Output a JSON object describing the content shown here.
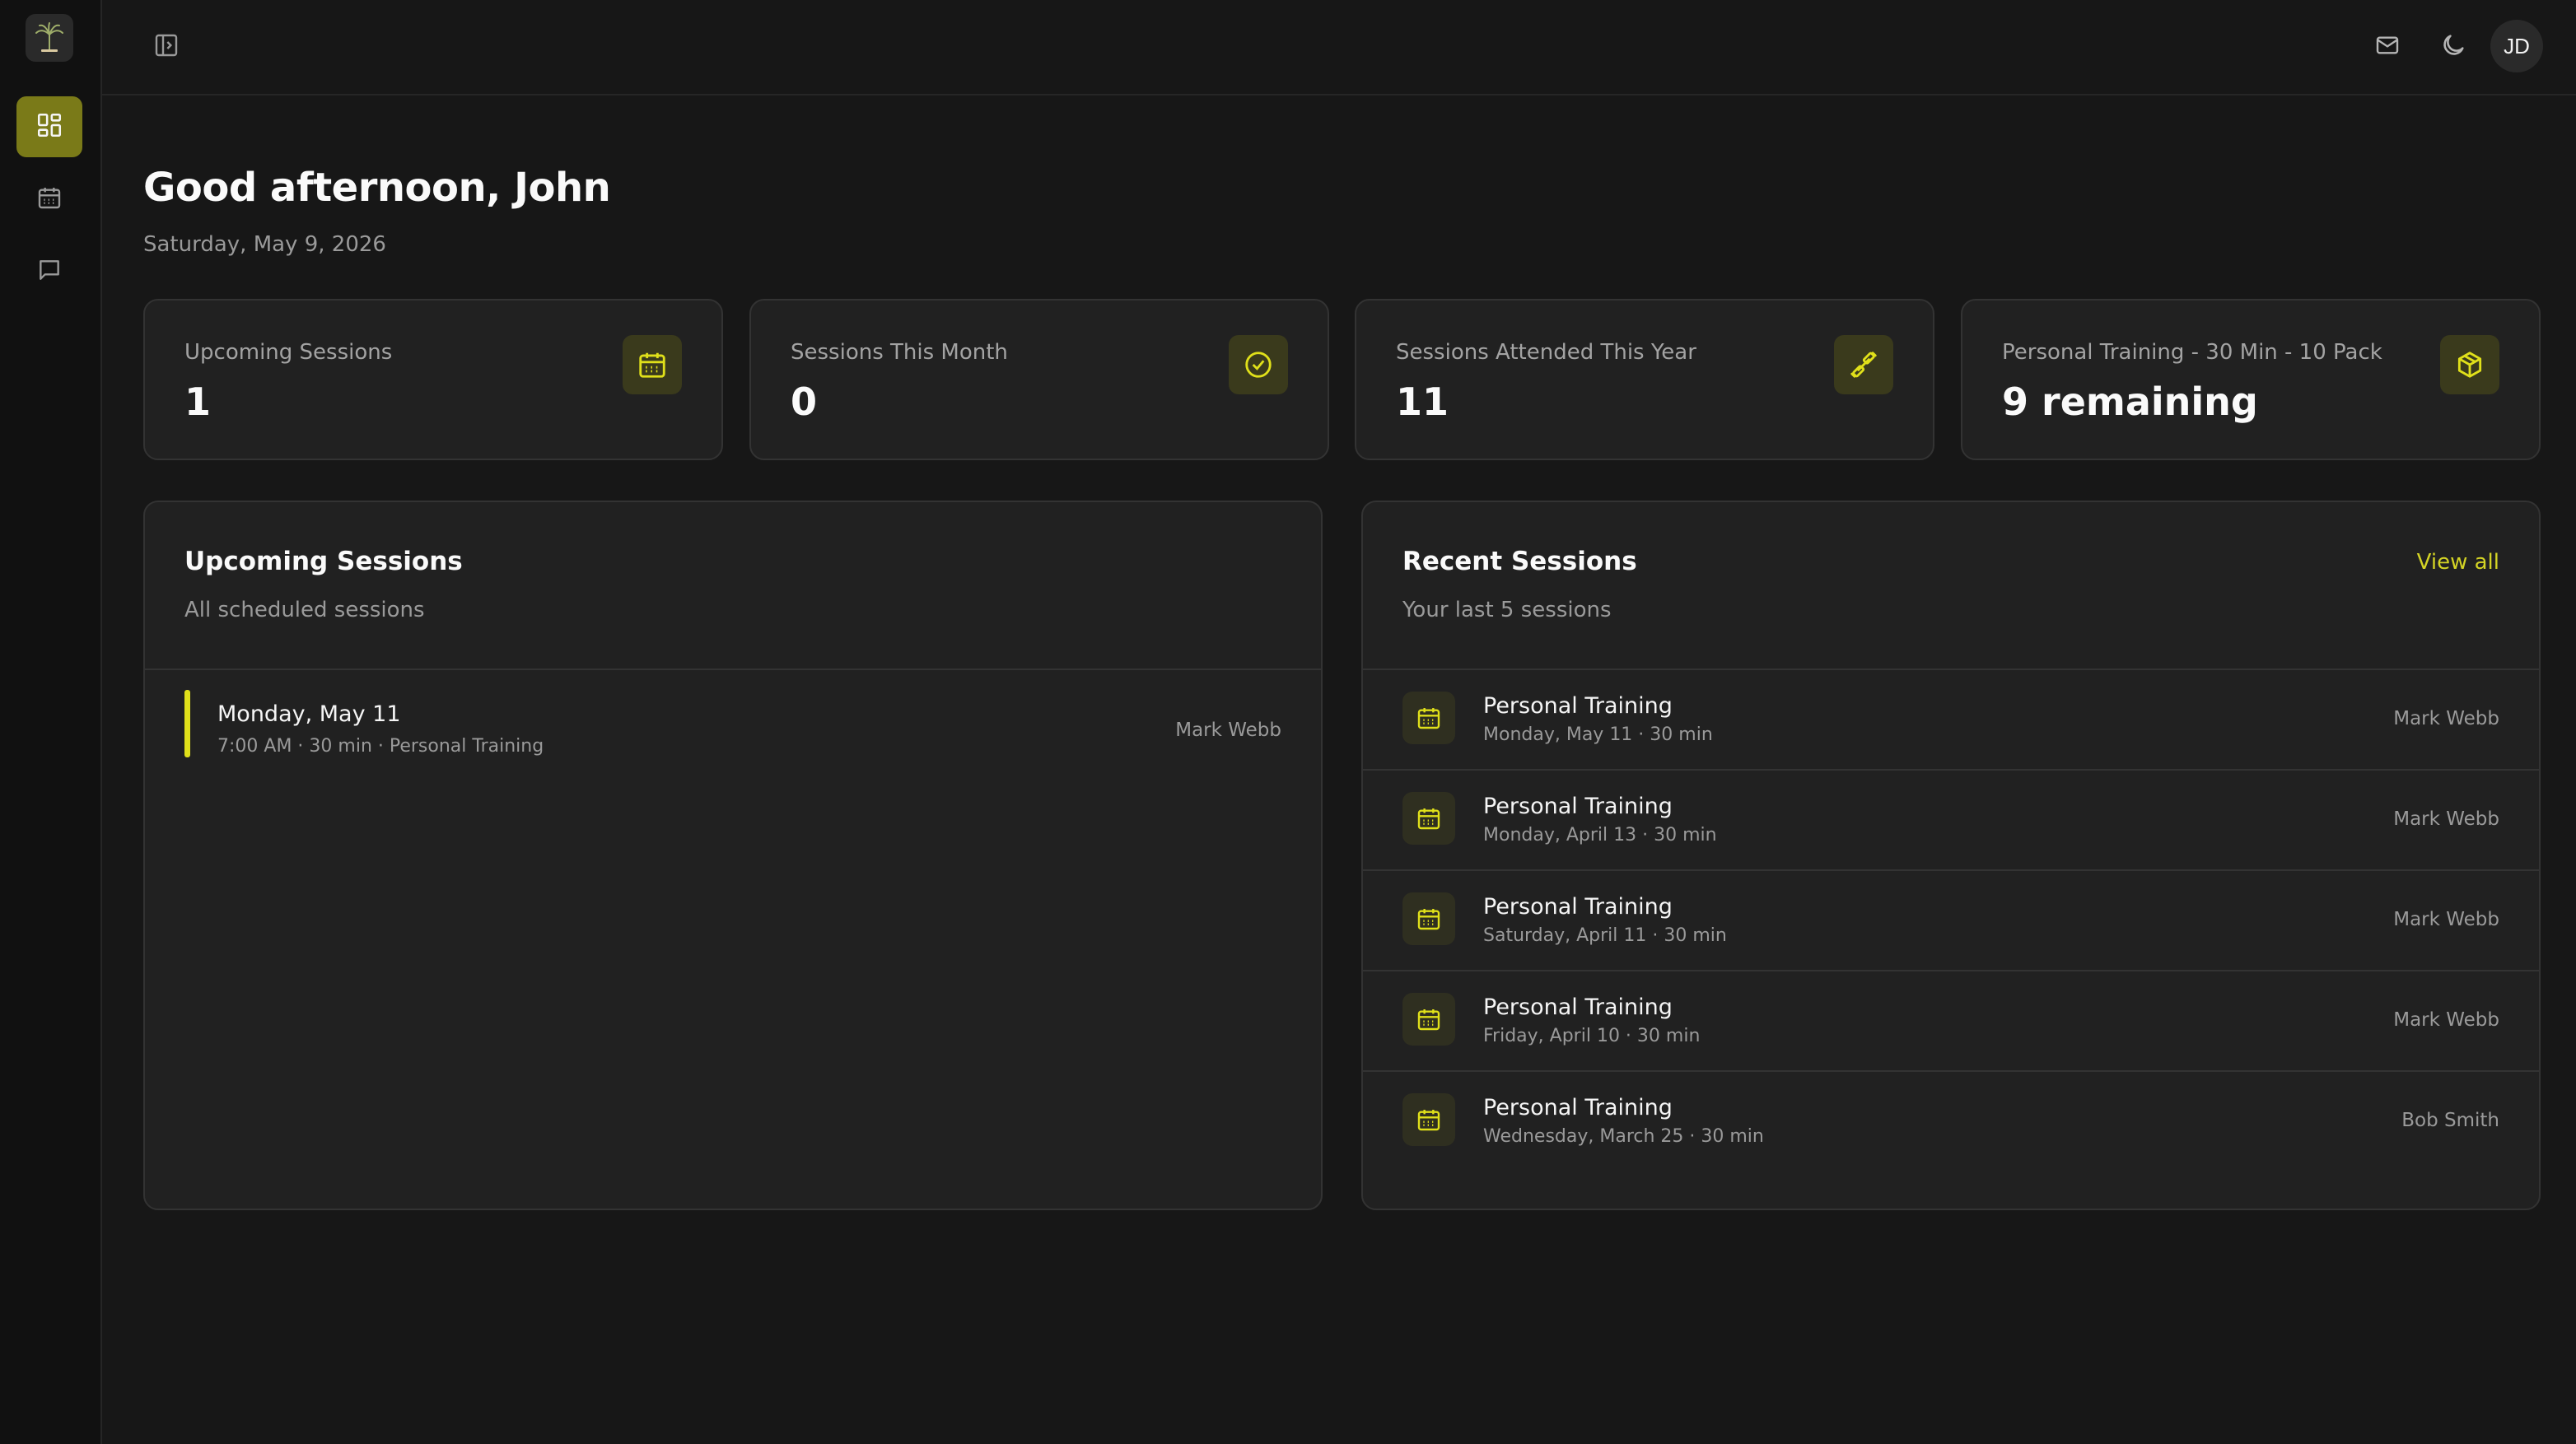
{
  "theme": {
    "accent": "#d4d425",
    "active_nav": "#7a7a18",
    "background": "#171717",
    "card": "#212121"
  },
  "sidebar": {
    "logo_icon": "palm-tree-logo",
    "items": [
      {
        "name": "dashboard",
        "icon": "grid-icon",
        "active": true
      },
      {
        "name": "calendar",
        "icon": "calendar-icon",
        "active": false
      },
      {
        "name": "messages",
        "icon": "chat-icon",
        "active": false
      }
    ]
  },
  "header": {
    "sidebar_toggle_icon": "sidebar-toggle-icon",
    "mail_icon": "mail-icon",
    "theme_icon": "moon-icon",
    "avatar_initials": "JD"
  },
  "greeting": "Good afternoon, John",
  "date": "Saturday, May 9, 2026",
  "stats": [
    {
      "label": "Upcoming Sessions",
      "value": "1",
      "icon": "calendar-icon"
    },
    {
      "label": "Sessions This Month",
      "value": "0",
      "icon": "check-circle-icon"
    },
    {
      "label": "Sessions Attended This Year",
      "value": "11",
      "icon": "dumbbell-icon"
    },
    {
      "label": "Personal Training - 30 Min - 10 Pack",
      "value": "9 remaining",
      "icon": "package-icon"
    }
  ],
  "upcoming": {
    "title": "Upcoming Sessions",
    "subtitle": "All scheduled sessions",
    "items": [
      {
        "title": "Monday, May 11",
        "meta": "7:00 AM · 30 min · Personal Training",
        "trainer": "Mark Webb"
      }
    ]
  },
  "recent": {
    "title": "Recent Sessions",
    "subtitle": "Your last 5 sessions",
    "view_all": "View all",
    "items": [
      {
        "title": "Personal Training",
        "meta": "Monday, May 11 · 30 min",
        "trainer": "Mark Webb"
      },
      {
        "title": "Personal Training",
        "meta": "Monday, April 13 · 30 min",
        "trainer": "Mark Webb"
      },
      {
        "title": "Personal Training",
        "meta": "Saturday, April 11 · 30 min",
        "trainer": "Mark Webb"
      },
      {
        "title": "Personal Training",
        "meta": "Friday, April 10 · 30 min",
        "trainer": "Mark Webb"
      },
      {
        "title": "Personal Training",
        "meta": "Wednesday, March 25 · 30 min",
        "trainer": "Bob Smith"
      }
    ]
  }
}
